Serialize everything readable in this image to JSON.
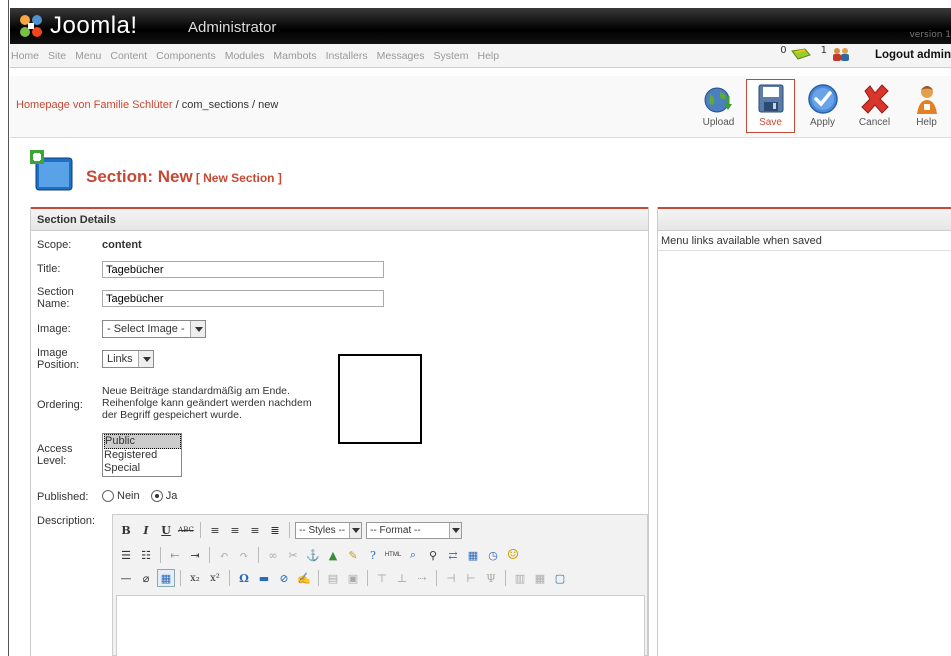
{
  "header": {
    "logo_text": "Joomla!",
    "logo_sub": "Administrator",
    "version": "version 1"
  },
  "menu": {
    "items": [
      "Home",
      "Site",
      "Menu",
      "Content",
      "Components",
      "Modules",
      "Mambots",
      "Installers",
      "Messages",
      "System",
      "Help"
    ]
  },
  "status": {
    "messages_count": "0",
    "online_count": "1",
    "logout_label": "Logout admin"
  },
  "pathway": {
    "site": "Homepage von Familie Schlüter",
    "rest": " / com_sections / new"
  },
  "toolbar": {
    "buttons": [
      {
        "label": "Upload",
        "icon": "upload-globe-icon"
      },
      {
        "label": "Save",
        "icon": "save-disk-icon"
      },
      {
        "label": "Apply",
        "icon": "apply-check-icon"
      },
      {
        "label": "Cancel",
        "icon": "cancel-x-icon"
      },
      {
        "label": "Help",
        "icon": "help-person-icon"
      }
    ]
  },
  "heading": {
    "main": "Section: New",
    "sub": "[ New Section ]"
  },
  "details": {
    "panel_title": "Section Details",
    "scope_label": "Scope:",
    "scope_value": "content",
    "title_label": "Title:",
    "title_value": "Tagebücher",
    "section_name_label": "Section Name:",
    "section_name_value": "Tagebücher",
    "image_label": "Image:",
    "image_select": "- Select Image -",
    "image_position_label": "Image Position:",
    "image_position_select": "Links",
    "ordering_label": "Ordering:",
    "ordering_text": "Neue Beiträge standardmäßig am Ende. Reihenfolge kann geändert werden nachdem der Begriff gespeichert wurde.",
    "access_label": "Access Level:",
    "access_options": [
      "Public",
      "Registered",
      "Special"
    ],
    "published_label": "Published:",
    "published_no": "Nein",
    "published_yes": "Ja",
    "description_label": "Description:"
  },
  "editor": {
    "styles_select": "-- Styles --",
    "format_select": "-- Format --"
  },
  "right_panel": {
    "message": "Menu links available when saved"
  },
  "colors": {
    "accent": "#c64934",
    "header_bg": "#000000"
  }
}
